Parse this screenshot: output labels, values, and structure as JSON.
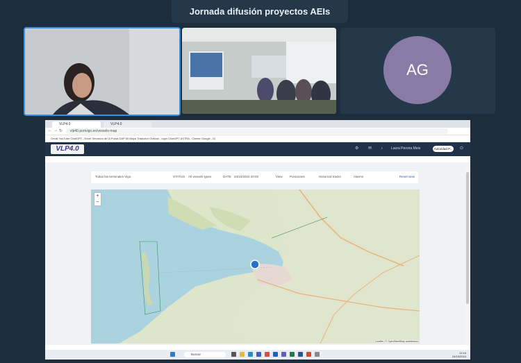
{
  "meeting": {
    "title": "Jornada difusión proyectos AEIs"
  },
  "participants": [
    {
      "type": "video",
      "name": ""
    },
    {
      "type": "video",
      "name": ""
    },
    {
      "type": "avatar",
      "initials": "AG"
    }
  ],
  "browser": {
    "tabs": [
      "VLP4.0",
      "VLP4.0"
    ],
    "url": "vlp40.portvigo.es/vessels-map",
    "bookmarks": "Gmail   YouTube   ChatGPT - Excel   Servicios de IA   Portal DAP   Mi Mapa   Traductor   Outlook - login   ChatGPT   ASTRA - Cliente   Google - ID"
  },
  "app": {
    "logo": "VLP4.0",
    "user_name": "Laura Pereira Meis",
    "user_button": "Autoridad P...",
    "filters": {
      "terminal": "Todas las terminales Vigo",
      "status_label": "STATUS",
      "status_value": "All vessels types",
      "date_label": "DATE",
      "date_value": "24/10/2024 20:00",
      "view_label": "View",
      "positions": "Posiciones",
      "historical": "Historical tracks",
      "alerts": "Alarms",
      "reset": "Reset view"
    },
    "map": {
      "zoom_in": "+",
      "zoom_out": "−",
      "attribution": "Leaflet | © OpenStreetMap contributors"
    }
  },
  "taskbar": {
    "search_placeholder": "Buscar",
    "time": "12:15",
    "date": "24/10/2024"
  }
}
